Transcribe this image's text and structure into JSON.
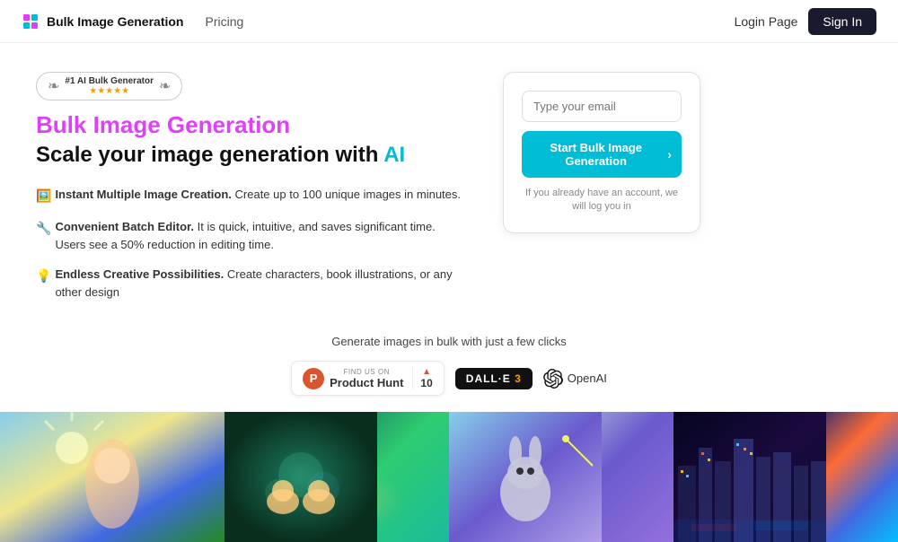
{
  "navbar": {
    "logo_text": "Bulk Image Generation",
    "nav_link": "Pricing",
    "login_label": "Login Page",
    "signin_label": "Sign In"
  },
  "hero": {
    "badge_rank": "#1 AI Bulk Generator",
    "title": "Bulk Image Generation",
    "subtitle_start": "Scale your image generation with ",
    "subtitle_ai": "AI",
    "feature1_icon": "🖼️",
    "feature1_bold": "Instant Multiple Image Creation.",
    "feature1_text": " Create up to 100 unique images in minutes.",
    "feature2_icon": "🔧",
    "feature2_bold": "Convenient Batch Editor.",
    "feature2_text": " It is quick, intuitive, and saves significant time. Users see a 50% reduction in editing time.",
    "feature3_icon": "💡",
    "feature3_bold": "Endless Creative Possibilities.",
    "feature3_text": " Create characters, book illustrations, or any other design"
  },
  "partners": {
    "label": "Generate images in bulk with just a few clicks",
    "ph_find": "FIND US ON",
    "ph_name": "Product Hunt",
    "ph_count": "10",
    "dalle_label": "DALL·E 3",
    "openai_label": "OpenAI"
  },
  "signup": {
    "email_placeholder": "Type your email",
    "cta_label": "Start Bulk Image Generation",
    "note": "If you already have an account, we will log you in"
  }
}
